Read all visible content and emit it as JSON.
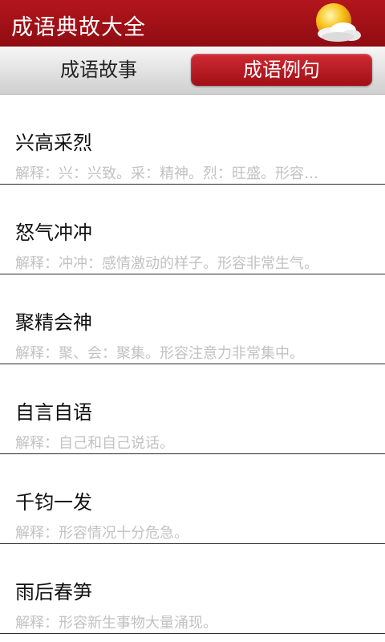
{
  "header": {
    "title": "成语典故大全",
    "weather_icon": "sun-cloud-icon"
  },
  "tabs": [
    {
      "label": "成语故事",
      "selected": false
    },
    {
      "label": "成语例句",
      "selected": true
    }
  ],
  "idioms": [
    {
      "name": "兴高采烈",
      "desc": "解释：兴：兴致。采：精神。烈：旺盛。形容…"
    },
    {
      "name": "怒气冲冲",
      "desc": "解释：冲冲：感情激动的样子。形容非常生气。"
    },
    {
      "name": "聚精会神",
      "desc": "解释：聚、会：聚集。形容注意力非常集中。"
    },
    {
      "name": "自言自语",
      "desc": "解释：自己和自己说话。"
    },
    {
      "name": "千钧一发",
      "desc": "解释：形容情况十分危急。"
    },
    {
      "name": "雨后春笋",
      "desc": "解释：形容新生事物大量涌现。"
    }
  ],
  "colors": {
    "titlebar": "#a01118",
    "active_tab": "#b81c24",
    "desc_text": "#c2c2c2"
  }
}
